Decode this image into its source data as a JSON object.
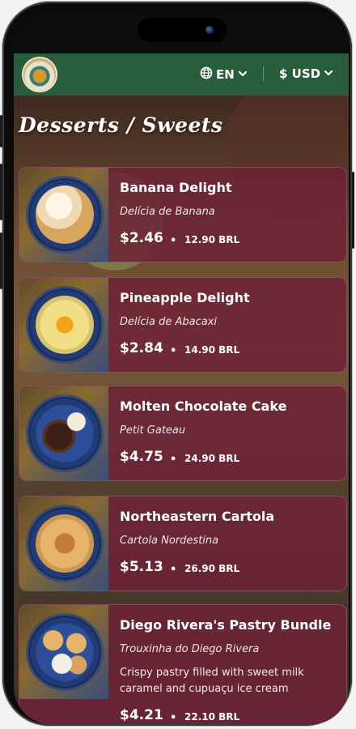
{
  "header": {
    "logo_name": "restaurant-logo",
    "language": "EN",
    "currency": "$ USD"
  },
  "page": {
    "title": "Desserts / Sweets"
  },
  "colors": {
    "appbar": "#2a5d3b",
    "card": "#6e2337"
  },
  "items": [
    {
      "name": "Banana Delight",
      "subtitle": "Delícia de Banana",
      "price": "$2.46",
      "separator": "•",
      "alt_price": "12.90 BRL"
    },
    {
      "name": "Pineapple Delight",
      "subtitle": "Delícia de Abacaxi",
      "price": "$2.84",
      "separator": "•",
      "alt_price": "14.90 BRL"
    },
    {
      "name": "Molten Chocolate Cake",
      "subtitle": "Petit Gateau",
      "price": "$4.75",
      "separator": "•",
      "alt_price": "24.90 BRL"
    },
    {
      "name": "Northeastern Cartola",
      "subtitle": "Cartola Nordestina",
      "price": "$5.13",
      "separator": "•",
      "alt_price": "26.90 BRL"
    },
    {
      "name": "Diego Rivera's Pastry Bundle",
      "subtitle": "Trouxinha do Diego Rivera",
      "description": "Crispy pastry filled with sweet milk caramel and cupuaçu ice cream",
      "price": "$4.21",
      "separator": "•",
      "alt_price": "22.10 BRL"
    }
  ]
}
